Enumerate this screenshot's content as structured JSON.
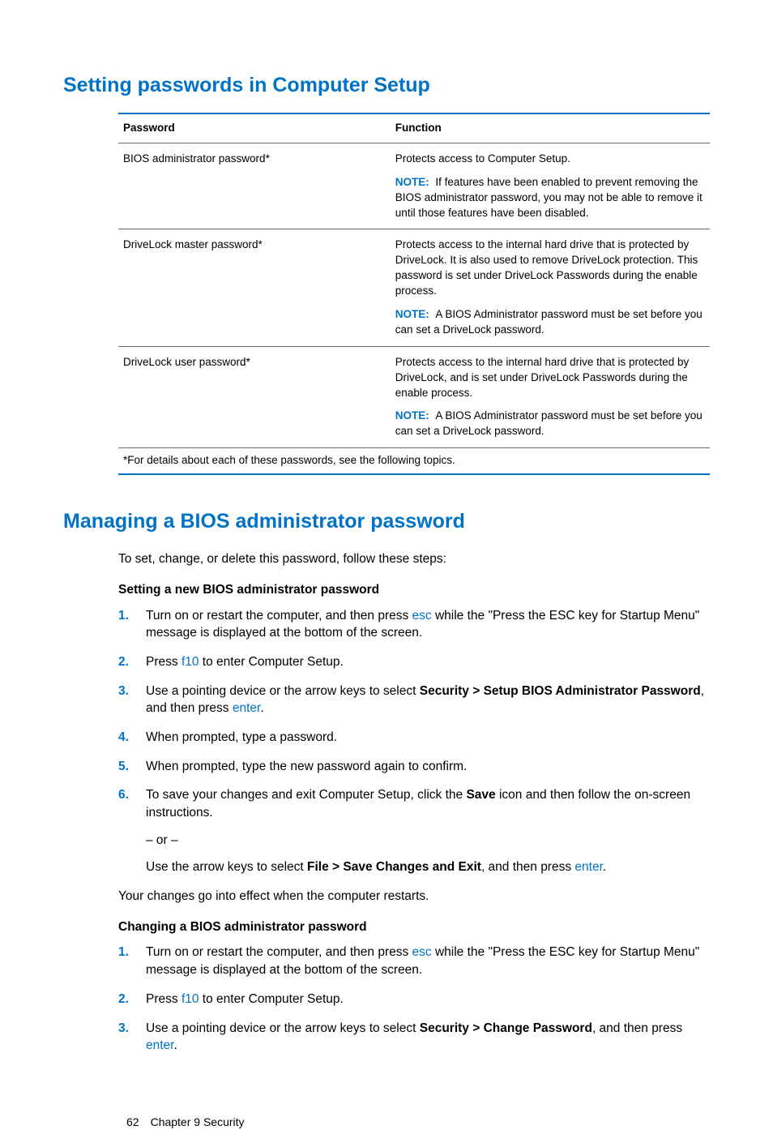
{
  "heading1": "Setting passwords in Computer Setup",
  "table": {
    "headers": {
      "c1": "Password",
      "c2": "Function"
    },
    "rows": [
      {
        "c1": "BIOS administrator password*",
        "p1": "Protects access to Computer Setup.",
        "noteLabel": "NOTE:",
        "note": "If features have been enabled to prevent removing the BIOS administrator password, you may not be able to remove it until those features have been disabled."
      },
      {
        "c1": "DriveLock master password*",
        "p1": "Protects access to the internal hard drive that is protected by DriveLock. It is also used to remove DriveLock protection. This password is set under DriveLock Passwords during the enable process.",
        "noteLabel": "NOTE:",
        "note": "A BIOS Administrator password must be set before you can set a DriveLock password."
      },
      {
        "c1": "DriveLock user password*",
        "p1": "Protects access to the internal hard drive that is protected by DriveLock, and is set under DriveLock Passwords during the enable process.",
        "noteLabel": "NOTE:",
        "note": "A BIOS Administrator password must be set before you can set a DriveLock password."
      }
    ],
    "footnote": "*For details about each of these passwords, see the following topics."
  },
  "heading2": "Managing a BIOS administrator password",
  "intro": "To set, change, or delete this password, follow these steps:",
  "subhead1": "Setting a new BIOS administrator password",
  "stepsA": {
    "s1a": "Turn on or restart the computer, and then press ",
    "s1key": "esc",
    "s1b": " while the \"Press the ESC key for Startup Menu\" message is displayed at the bottom of the screen.",
    "s2a": "Press ",
    "s2key": "f10",
    "s2b": " to enter Computer Setup.",
    "s3a": "Use a pointing device or the arrow keys to select ",
    "s3bold": "Security > Setup BIOS Administrator Password",
    "s3b": ", and then press ",
    "s3key": "enter",
    "s3c": ".",
    "s4": "When prompted, type a password.",
    "s5": "When prompted, type the new password again to confirm.",
    "s6a": "To save your changes and exit Computer Setup, click the ",
    "s6bold": "Save",
    "s6b": " icon and then follow the on-screen instructions.",
    "or": "– or –",
    "s6c": "Use the arrow keys to select ",
    "s6bold2": "File > Save Changes and Exit",
    "s6d": ", and then press ",
    "s6key": "enter",
    "s6e": "."
  },
  "after1": "Your changes go into effect when the computer restarts.",
  "subhead2": "Changing a BIOS administrator password",
  "stepsB": {
    "s1a": "Turn on or restart the computer, and then press ",
    "s1key": "esc",
    "s1b": " while the \"Press the ESC key for Startup Menu\" message is displayed at the bottom of the screen.",
    "s2a": "Press ",
    "s2key": "f10",
    "s2b": " to enter Computer Setup.",
    "s3a": "Use a pointing device or the arrow keys to select ",
    "s3bold": "Security > Change Password",
    "s3b": ", and then press ",
    "s3key": "enter",
    "s3c": "."
  },
  "footer": {
    "page": "62",
    "chapter": "Chapter 9   Security"
  }
}
